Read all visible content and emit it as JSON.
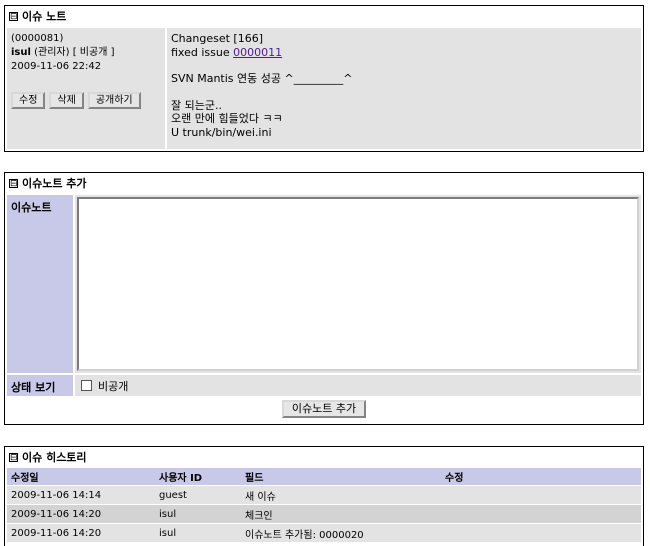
{
  "note": {
    "title": "이슈 노트",
    "id": "(0000081)",
    "user": "isul",
    "role": "(관리자)",
    "privacy": "[ 비공개 ]",
    "timestamp": "2009-11-06 22:42",
    "buttons": {
      "edit": "수정",
      "delete": "삭제",
      "make_public": "공개하기"
    },
    "body": {
      "line1": "Changeset [166]",
      "fixed_prefix": "fixed issue ",
      "issue_link": "0000011",
      "line3": "SVN Mantis 연동 성공 ^_________^",
      "line4": "잘 되는군..",
      "line5": "오랜 만에 힘들었다 ㅋㅋ",
      "line6": "U trunk/bin/wei.ini"
    }
  },
  "add_note": {
    "title": "이슈노트 추가",
    "label_note": "이슈노트",
    "label_state": "상태 보기",
    "private_label": "비공개",
    "private_checked": false,
    "textarea_value": "",
    "submit_label": "이슈노트 추가"
  },
  "history": {
    "title": "이슈 히스토리",
    "columns": [
      "수정일",
      "사용자 ID",
      "필드",
      "수정"
    ],
    "rows": [
      {
        "date": "2009-11-06 14:14",
        "user": "guest",
        "field": "새 이슈",
        "change": ""
      },
      {
        "date": "2009-11-06 14:20",
        "user": "isul",
        "field": "체크인",
        "change": ""
      },
      {
        "date": "2009-11-06 14:20",
        "user": "isul",
        "field": "이슈노트 추가됨: 0000020",
        "change": ""
      }
    ]
  },
  "colors": {
    "label_bg": "#c8c8e8",
    "row_bg": "#e3e3e3",
    "link": "#551a8b"
  }
}
